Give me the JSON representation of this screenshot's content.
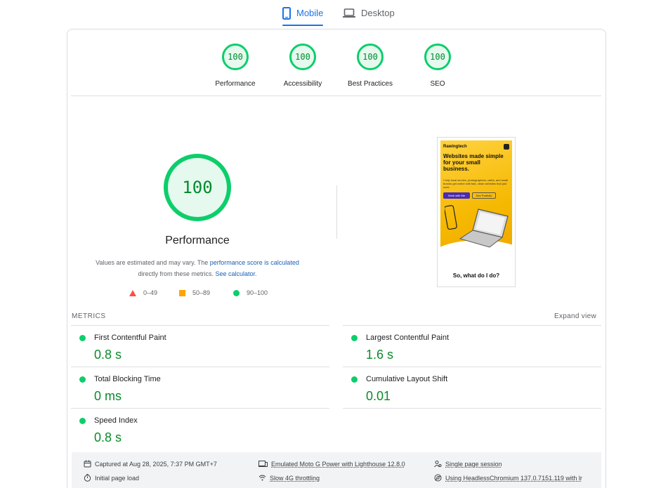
{
  "tabs": [
    {
      "label": "Mobile",
      "icon": "phone-icon",
      "active": true
    },
    {
      "label": "Desktop",
      "icon": "laptop-icon",
      "active": false
    }
  ],
  "categories": [
    {
      "score": "100",
      "label": "Performance"
    },
    {
      "score": "100",
      "label": "Accessibility"
    },
    {
      "score": "100",
      "label": "Best Practices"
    },
    {
      "score": "100",
      "label": "SEO"
    }
  ],
  "performance": {
    "score": "100",
    "title": "Performance",
    "desc_text1": "Values are estimated and may vary. The ",
    "desc_link1": "performance score is calculated",
    "desc_text2": "directly from these metrics. ",
    "desc_link2": "See calculator",
    "desc_text3": "."
  },
  "legend": [
    {
      "range": "0–49",
      "shape": "triangle",
      "color": "#ff4e42"
    },
    {
      "range": "50–89",
      "shape": "square",
      "color": "#ffa400"
    },
    {
      "range": "90–100",
      "shape": "circle",
      "color": "#0cce6b"
    }
  ],
  "screenshot": {
    "brand": "Rawingtech",
    "headline": "Websites made simple for your small business.",
    "subtext": "I help local service, photographers, cafés, and small brands get online with fast, clean websites that just work.",
    "primary_button": "Work with Me",
    "secondary_button": "See Portfolio",
    "footer": "So, what do I do?"
  },
  "metrics": {
    "heading": "METRICS",
    "expand_label": "Expand view",
    "items": [
      {
        "label": "First Contentful Paint",
        "value": "0.8 s"
      },
      {
        "label": "Largest Contentful Paint",
        "value": "1.6 s"
      },
      {
        "label": "Total Blocking Time",
        "value": "0 ms"
      },
      {
        "label": "Cumulative Layout Shift",
        "value": "0.01"
      },
      {
        "label": "Speed Index",
        "value": "0.8 s"
      }
    ]
  },
  "info": {
    "captured": "Captured at Aug 28, 2025, 7:37 PM GMT+7",
    "load": "Initial page load",
    "device": "Emulated Moto G Power with Lighthouse 12.8.0",
    "throttling": "Slow 4G throttling",
    "session": "Single page session",
    "browser": "Using HeadlessChromium 137.0.7151.119 with lr"
  },
  "colors": {
    "pass": "#0cce6b",
    "accent": "#1a73e8"
  }
}
